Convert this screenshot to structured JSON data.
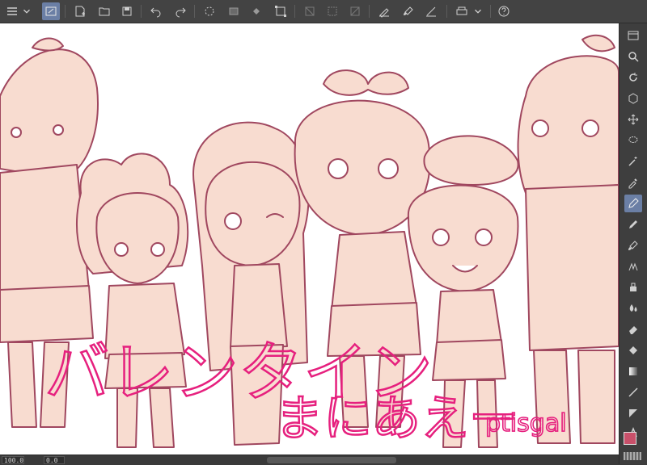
{
  "app": {
    "accent_color": "#6b7fa5",
    "canvas_bg": "#ffffff",
    "line_color": "#a0475f",
    "fill_color": "#f8dcd0"
  },
  "toolbar": {
    "icons": [
      "menu-icon",
      "chevron-down-icon",
      "canvas-icon",
      "new-file-icon",
      "open-folder-icon",
      "save-icon",
      "undo-icon",
      "redo-icon",
      "loading-spinner-icon",
      "fill-icon",
      "paint-bucket-icon",
      "transform-icon",
      "hide-icon",
      "select-all-icon",
      "clear-icon",
      "pen-stabilizer-icon",
      "brush-icon",
      "ruler-icon",
      "printer-icon",
      "chevron-down-icon",
      "help-icon"
    ]
  },
  "right_tools": {
    "icons": [
      "window-icon",
      "zoom-icon",
      "rotate-icon",
      "3d-object-icon",
      "move-icon",
      "lasso-icon",
      "magic-wand-icon",
      "eyedropper-icon",
      "pen-icon",
      "pencil-icon",
      "brush-icon",
      "airbrush-icon",
      "decoration-icon",
      "eraser-icon",
      "blend-icon",
      "fill-icon",
      "gradient-icon",
      "line-icon",
      "frame-icon",
      "text-icon"
    ],
    "active_index": 8
  },
  "status": {
    "zoom": "100.0",
    "rotation": "0.0"
  },
  "colors": {
    "foreground": "#c8506a",
    "background": "#ffffff"
  },
  "artwork": {
    "title_text": "バレンタイン",
    "subtitle_text": "まにあえー",
    "signature": "ptisgal"
  }
}
